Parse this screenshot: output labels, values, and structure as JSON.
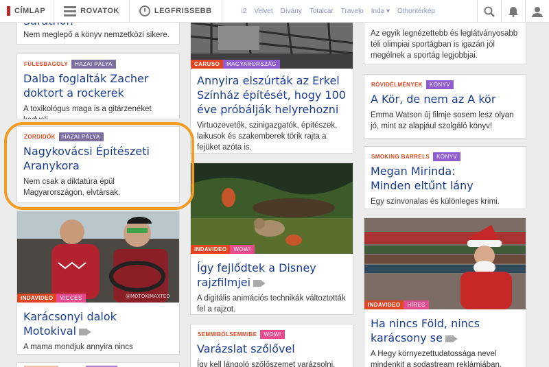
{
  "nav": {
    "home": "CÍMLAP",
    "sections": "ROVATOK",
    "latest": "LEGFRISSEBB",
    "links": [
      "i2",
      "Velvet",
      "Dívány",
      "Totalcar",
      "Travelo",
      "Inda ▾",
      "Othontérkép"
    ]
  },
  "colors": {
    "orange": "#f29c23",
    "tag_kicker": "#e0451f",
    "tag_purple": "#8f5bd0",
    "tag_gray": "#7c6fa0",
    "tag_pink": "#e84a8e",
    "link": "#1b3d8f"
  },
  "col1": {
    "top_sub": "Nem meglepő a könyv nemzetközi sikere.",
    "top_title": "Sarathon",
    "card1": {
      "kicker": "FÜLESBAGOLY",
      "section": "HAZAI PÁLYA",
      "title": "Dalba foglalták Zacher doktort a rockerek",
      "sub": "A toxikológus maga is a gitárzenéket kedveli."
    },
    "card2": {
      "kicker": "ZORDIDÓK",
      "section": "HAZAI PÁLYA",
      "title": "Nagykovácsi Építészeti Aranykora",
      "sub": "Nem csak a diktatúra épül Magyarországon, elvtársak."
    },
    "card3": {
      "kicker": "INDAVIDEO",
      "section": "VICCES",
      "title": "Karácsonyi dalok Motokival",
      "sub": "A mama mondjuk annyira nincs elragadtatva fia tehetségétől.",
      "watermark": "@MOTOKIMAXTED"
    }
  },
  "col2": {
    "card1": {
      "kicker": "CARUSO",
      "section": "MAGYARORSZÁG",
      "title": "Annyira elszúrták az Erkel Színház építését, hogy 100 éve próbálják helyrehozni",
      "sub": "Virtuozevetők, szinigazgatók, építészek, laikusok és szakemberek törik rajta a fejüket azóta is."
    },
    "card2": {
      "kicker": "INDAVIDEO",
      "section": "WOW!",
      "title": "Így fejlődtek a Disney rajzfilmjei",
      "sub": "A digitális animációs technikák változtották fel a rajzot."
    },
    "card3": {
      "kicker": "SEMMIBŐLSEMMIBE",
      "section": "WOW!",
      "title": "Varázslat szőlővel",
      "sub": "Így kell lángoló szőlőszemet varázsolni."
    }
  },
  "col3": {
    "top_sub": "Az egyik legnézettebb és leglátványosabb téli olimpiai sportágban is igazán jól megélnek a sportág legjobbjai.",
    "card1": {
      "kicker": "RÖVIDÉLMÉNYEK",
      "section": "KÖNYV",
      "title": "A Kör, de nem az A kör",
      "sub": "Emma Watson új filmje sosem lesz olyan jó, mint az alapjául szolgáló könyv!"
    },
    "card2": {
      "kicker": "SMOKING BARRELS",
      "section": "KÖNYV",
      "title": "Megan Mirinda: Minden eltűnt lány",
      "sub": "Egy színvonalas és különleges krimi."
    },
    "card3": {
      "kicker": "INDAVIDEO",
      "section": "HÍRES",
      "title": "Ha nincs Föld, nincs karácsony se",
      "sub": "A Hegy környezettudatossága nevel mindenkit a sodastream reklámjában."
    }
  }
}
